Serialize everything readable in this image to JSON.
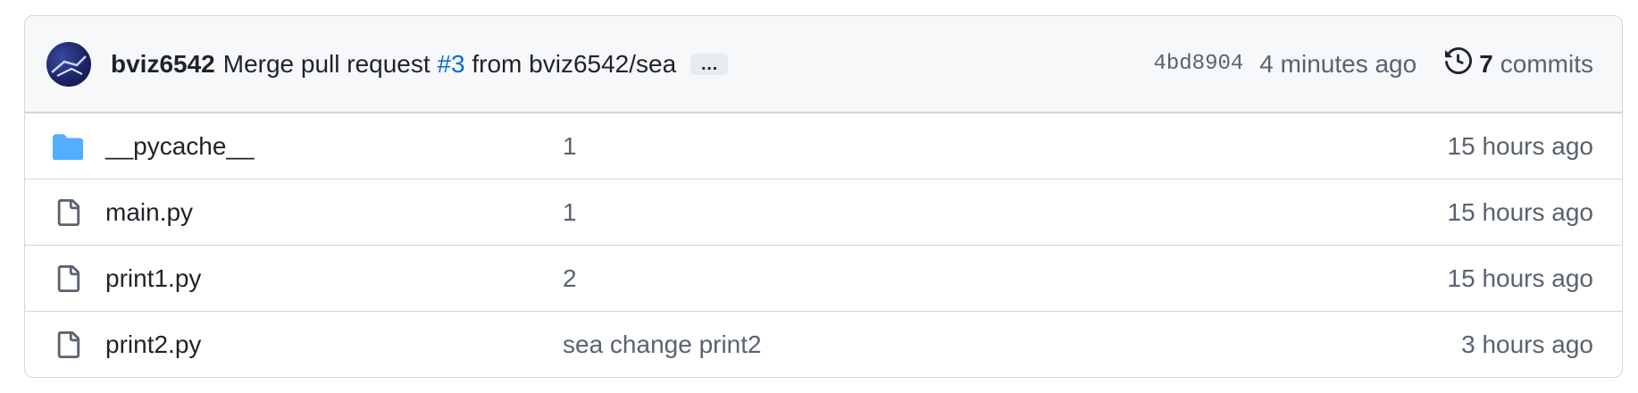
{
  "commit": {
    "author": "bviz6542",
    "message_prefix": "Merge pull request",
    "pr_link": "#3",
    "message_suffix": "from bviz6542/sea",
    "ellipsis": "…",
    "sha": "4bd8904",
    "time": "4 minutes ago",
    "commits_count": "7",
    "commits_label": "commits"
  },
  "files": [
    {
      "name": "__pycache__",
      "type": "folder",
      "message": "1",
      "time": "15 hours ago"
    },
    {
      "name": "main.py",
      "type": "file",
      "message": "1",
      "time": "15 hours ago"
    },
    {
      "name": "print1.py",
      "type": "file",
      "message": "2",
      "time": "15 hours ago"
    },
    {
      "name": "print2.py",
      "type": "file",
      "message": "sea change print2",
      "time": "3 hours ago"
    }
  ],
  "colors": {
    "link": "#0969da",
    "folder": "#54aeff",
    "muted": "#59636e",
    "border": "#d0d7de",
    "header_bg": "#f6f8fa"
  },
  "icons": {
    "history": "history-icon",
    "folder": "folder-icon",
    "file": "file-icon"
  }
}
